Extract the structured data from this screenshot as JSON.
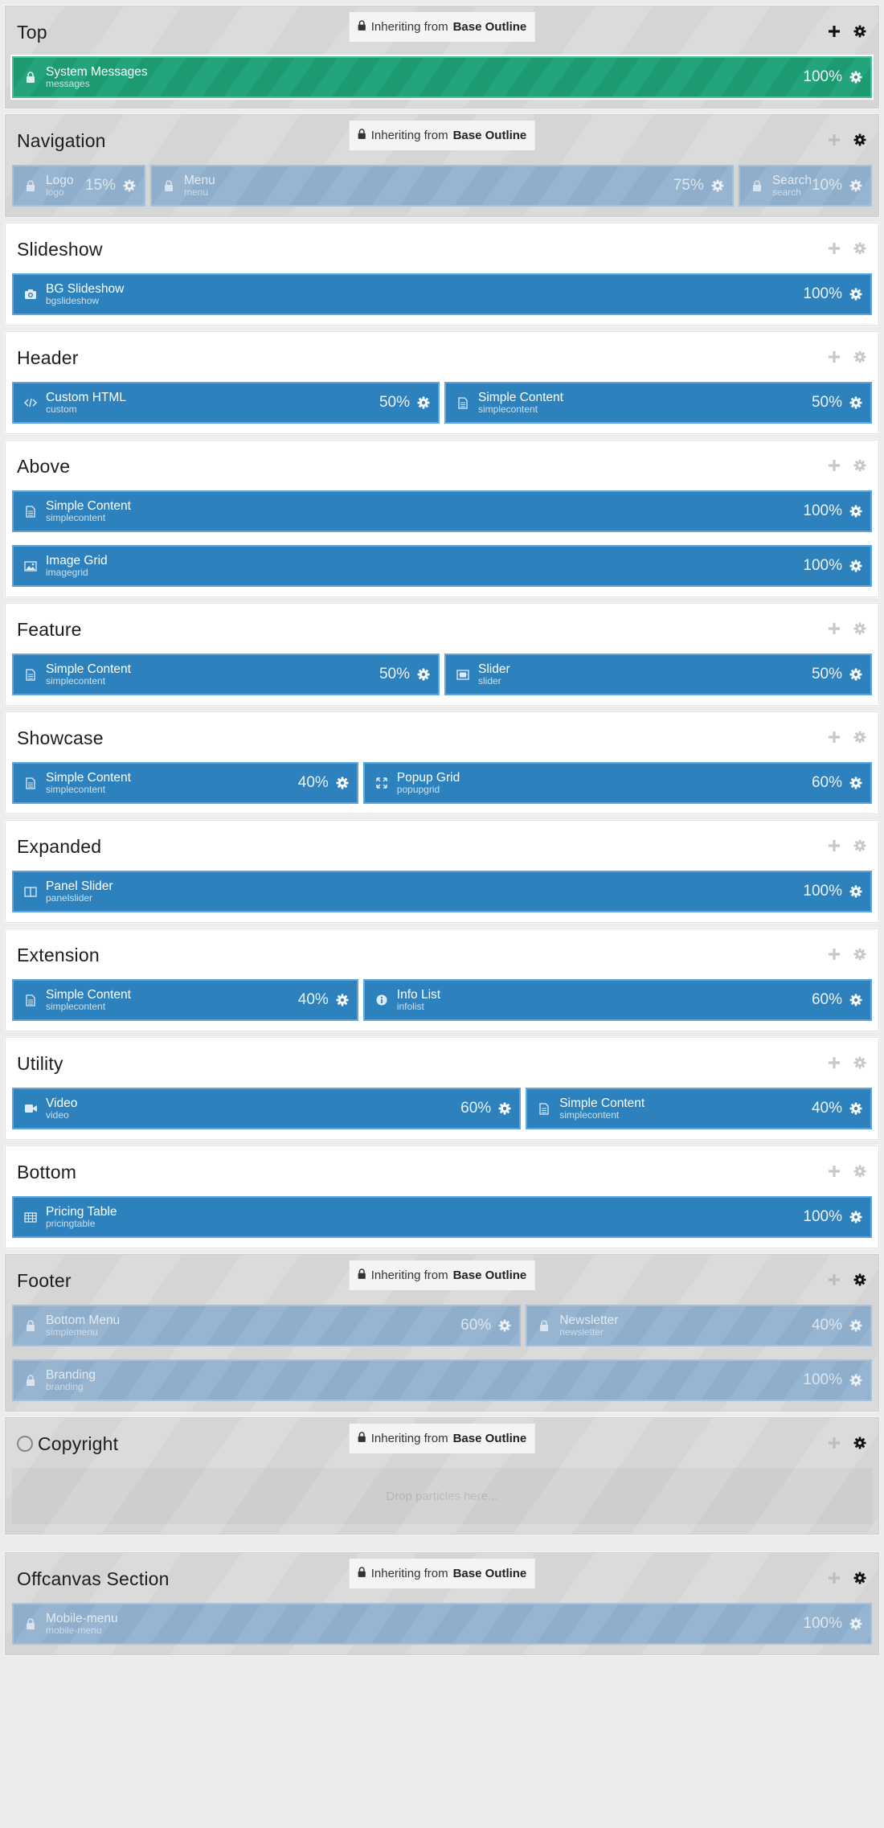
{
  "colors": {
    "particle_blue": "#2d82bd",
    "particle_green": "#1c9a72",
    "locked_blue": "#8eaecb"
  },
  "inherit_prefix": "Inheriting from",
  "inherit_source": "Base Outline",
  "drop_placeholder": "Drop particles here...",
  "sections": [
    {
      "title": "Top",
      "inherited": true,
      "rows": [
        [
          {
            "name": "System Messages",
            "type": "messages",
            "pct": "100%",
            "icon": "lock-icon",
            "style": "green",
            "flex": 100
          }
        ]
      ]
    },
    {
      "title": "Navigation",
      "inherited": true,
      "rows": [
        [
          {
            "name": "Logo",
            "type": "logo",
            "pct": "15%",
            "icon": "lock-icon",
            "style": "locked",
            "flex": 15
          },
          {
            "name": "Menu",
            "type": "menu",
            "pct": "75%",
            "icon": "lock-icon",
            "style": "locked",
            "flex": 75
          },
          {
            "name": "Search",
            "type": "search",
            "pct": "10%",
            "icon": "lock-icon",
            "style": "locked",
            "flex": 10
          }
        ]
      ]
    },
    {
      "title": "Slideshow",
      "inherited": false,
      "rows": [
        [
          {
            "name": "BG Slideshow",
            "type": "bgslideshow",
            "pct": "100%",
            "icon": "camera-icon",
            "flex": 100
          }
        ]
      ]
    },
    {
      "title": "Header",
      "inherited": false,
      "rows": [
        [
          {
            "name": "Custom HTML",
            "type": "custom",
            "pct": "50%",
            "icon": "code-icon",
            "flex": 50
          },
          {
            "name": "Simple Content",
            "type": "simplecontent",
            "pct": "50%",
            "icon": "document-icon",
            "flex": 50
          }
        ]
      ]
    },
    {
      "title": "Above",
      "inherited": false,
      "rows": [
        [
          {
            "name": "Simple Content",
            "type": "simplecontent",
            "pct": "100%",
            "icon": "document-icon",
            "flex": 100
          }
        ],
        [
          {
            "name": "Image Grid",
            "type": "imagegrid",
            "pct": "100%",
            "icon": "image-icon",
            "flex": 100
          }
        ]
      ]
    },
    {
      "title": "Feature",
      "inherited": false,
      "rows": [
        [
          {
            "name": "Simple Content",
            "type": "simplecontent",
            "pct": "50%",
            "icon": "document-icon",
            "flex": 50
          },
          {
            "name": "Slider",
            "type": "slider",
            "pct": "50%",
            "icon": "slider-icon",
            "flex": 50
          }
        ]
      ]
    },
    {
      "title": "Showcase",
      "inherited": false,
      "rows": [
        [
          {
            "name": "Simple Content",
            "type": "simplecontent",
            "pct": "40%",
            "icon": "document-icon",
            "flex": 40
          },
          {
            "name": "Popup Grid",
            "type": "popupgrid",
            "pct": "60%",
            "icon": "expand-icon",
            "flex": 60
          }
        ]
      ]
    },
    {
      "title": "Expanded",
      "inherited": false,
      "rows": [
        [
          {
            "name": "Panel Slider",
            "type": "panelslider",
            "pct": "100%",
            "icon": "columns-icon",
            "flex": 100
          }
        ]
      ]
    },
    {
      "title": "Extension",
      "inherited": false,
      "rows": [
        [
          {
            "name": "Simple Content",
            "type": "simplecontent",
            "pct": "40%",
            "icon": "document-icon",
            "flex": 40
          },
          {
            "name": "Info List",
            "type": "infolist",
            "pct": "60%",
            "icon": "info-icon",
            "flex": 60
          }
        ]
      ]
    },
    {
      "title": "Utility",
      "inherited": false,
      "rows": [
        [
          {
            "name": "Video",
            "type": "video",
            "pct": "60%",
            "icon": "video-icon",
            "flex": 60
          },
          {
            "name": "Simple Content",
            "type": "simplecontent",
            "pct": "40%",
            "icon": "document-icon",
            "flex": 40
          }
        ]
      ]
    },
    {
      "title": "Bottom",
      "inherited": false,
      "rows": [
        [
          {
            "name": "Pricing Table",
            "type": "pricingtable",
            "pct": "100%",
            "icon": "table-icon",
            "flex": 100
          }
        ]
      ]
    },
    {
      "title": "Footer",
      "inherited": true,
      "rows": [
        [
          {
            "name": "Bottom Menu",
            "type": "simplemenu",
            "pct": "60%",
            "icon": "lock-icon",
            "style": "locked",
            "flex": 60
          },
          {
            "name": "Newsletter",
            "type": "newsletter",
            "pct": "40%",
            "icon": "lock-icon",
            "style": "locked",
            "flex": 40
          }
        ],
        [
          {
            "name": "Branding",
            "type": "branding",
            "pct": "100%",
            "icon": "lock-icon",
            "style": "locked",
            "flex": 100
          }
        ]
      ]
    },
    {
      "title": "Copyright",
      "inherited": true,
      "radio": true,
      "empty": true,
      "rows": []
    },
    {
      "title": "Offcanvas Section",
      "inherited": true,
      "offcanvas": true,
      "rows": [
        [
          {
            "name": "Mobile-menu",
            "type": "mobile-menu",
            "pct": "100%",
            "icon": "lock-icon",
            "style": "locked",
            "flex": 100
          }
        ]
      ]
    }
  ]
}
